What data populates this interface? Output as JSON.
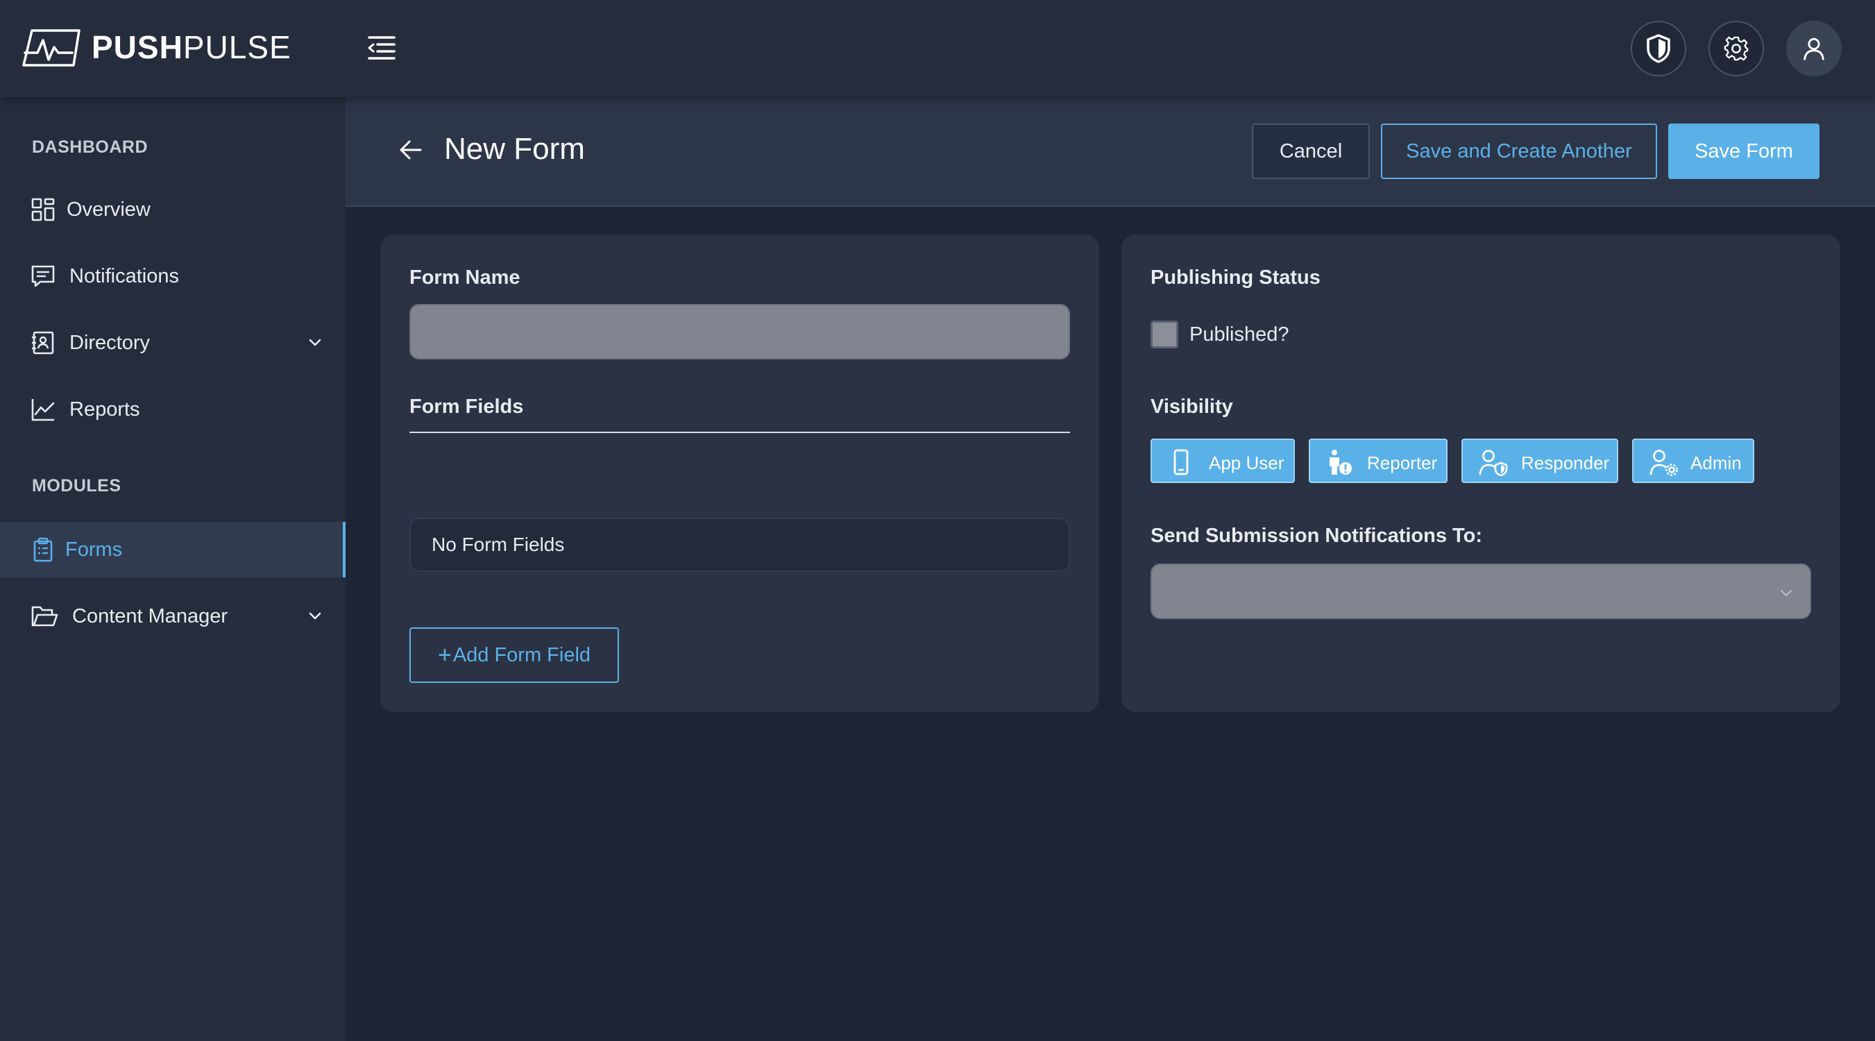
{
  "app": {
    "brand_bold": "PUSH",
    "brand_light": "PULSE"
  },
  "topbar": {
    "icons": [
      "menu-collapse-icon",
      "shield-icon",
      "gear-icon",
      "user-icon"
    ]
  },
  "sidebar": {
    "sections": [
      {
        "label": "DASHBOARD",
        "items": [
          {
            "label": "Overview",
            "icon": "grid-icon"
          },
          {
            "label": "Notifications",
            "icon": "message-icon"
          },
          {
            "label": "Directory",
            "icon": "contact-book-icon",
            "expandable": true
          },
          {
            "label": "Reports",
            "icon": "line-chart-icon"
          }
        ]
      },
      {
        "label": "MODULES",
        "items": [
          {
            "label": "Forms",
            "icon": "clipboard-icon",
            "active": true
          },
          {
            "label": "Content Manager",
            "icon": "folder-icon",
            "expandable": true
          }
        ]
      }
    ]
  },
  "header": {
    "title": "New Form",
    "cancel_label": "Cancel",
    "save_another_label": "Save and Create Another",
    "save_label": "Save Form"
  },
  "form": {
    "name_label": "Form Name",
    "name_value": "",
    "fields_label": "Form Fields",
    "empty_text": "No Form Fields",
    "add_field_plus": "+",
    "add_field_label": "Add Form Field"
  },
  "settings": {
    "publishing_label": "Publishing Status",
    "published_label": "Published?",
    "published": false,
    "visibility_label": "Visibility",
    "visibility_options": [
      {
        "label": "App User",
        "icon": "phone-icon"
      },
      {
        "label": "Reporter",
        "icon": "reporter-icon"
      },
      {
        "label": "Responder",
        "icon": "responder-icon"
      },
      {
        "label": "Admin",
        "icon": "admin-icon"
      }
    ],
    "notify_label": "Send Submission Notifications To:",
    "notify_value": ""
  },
  "colors": {
    "accent": "#5ab1e8",
    "background": "#1d2433",
    "panel": "#252d3d",
    "card": "#2a3244"
  }
}
